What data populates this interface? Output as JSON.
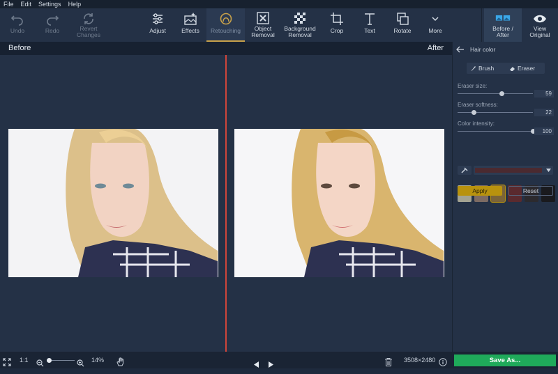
{
  "menu": {
    "file": "File",
    "edit": "Edit",
    "settings": "Settings",
    "help": "Help"
  },
  "toolbar": {
    "undo": "Undo",
    "redo": "Redo",
    "revert_1": "Revert",
    "revert_2": "Changes",
    "adjust": "Adjust",
    "effects": "Effects",
    "retouching": "Retouching",
    "object_1": "Object",
    "object_2": "Removal",
    "background_1": "Background",
    "background_2": "Removal",
    "crop": "Crop",
    "text": "Text",
    "rotate": "Rotate",
    "more": "More",
    "before_after_1": "Before /",
    "before_after_2": "After",
    "view_original_1": "View",
    "view_original_2": "Original"
  },
  "canvas": {
    "before_label": "Before",
    "after_label": "After"
  },
  "panel": {
    "title": "Hair color",
    "brush": "Brush",
    "eraser": "Eraser",
    "eraser_size_label": "Eraser size:",
    "eraser_size_value": "59",
    "eraser_size": 59,
    "eraser_softness_label": "Eraser softness:",
    "eraser_softness_value": "22",
    "eraser_softness": 22,
    "color_intensity_label": "Color intensity:",
    "color_intensity_value": "100",
    "color_intensity": 100,
    "swatches": [
      "#a3a392",
      "#7d6b63",
      "#7b6438",
      "#5a2a2e",
      "#2c2a2e",
      "#1a1a1e"
    ],
    "apply": "Apply",
    "reset": "Reset",
    "accent": "#b8920e"
  },
  "status": {
    "fit": "1:1",
    "zoom": "14%",
    "dimensions": "3508×2480",
    "save": "Save As..."
  }
}
